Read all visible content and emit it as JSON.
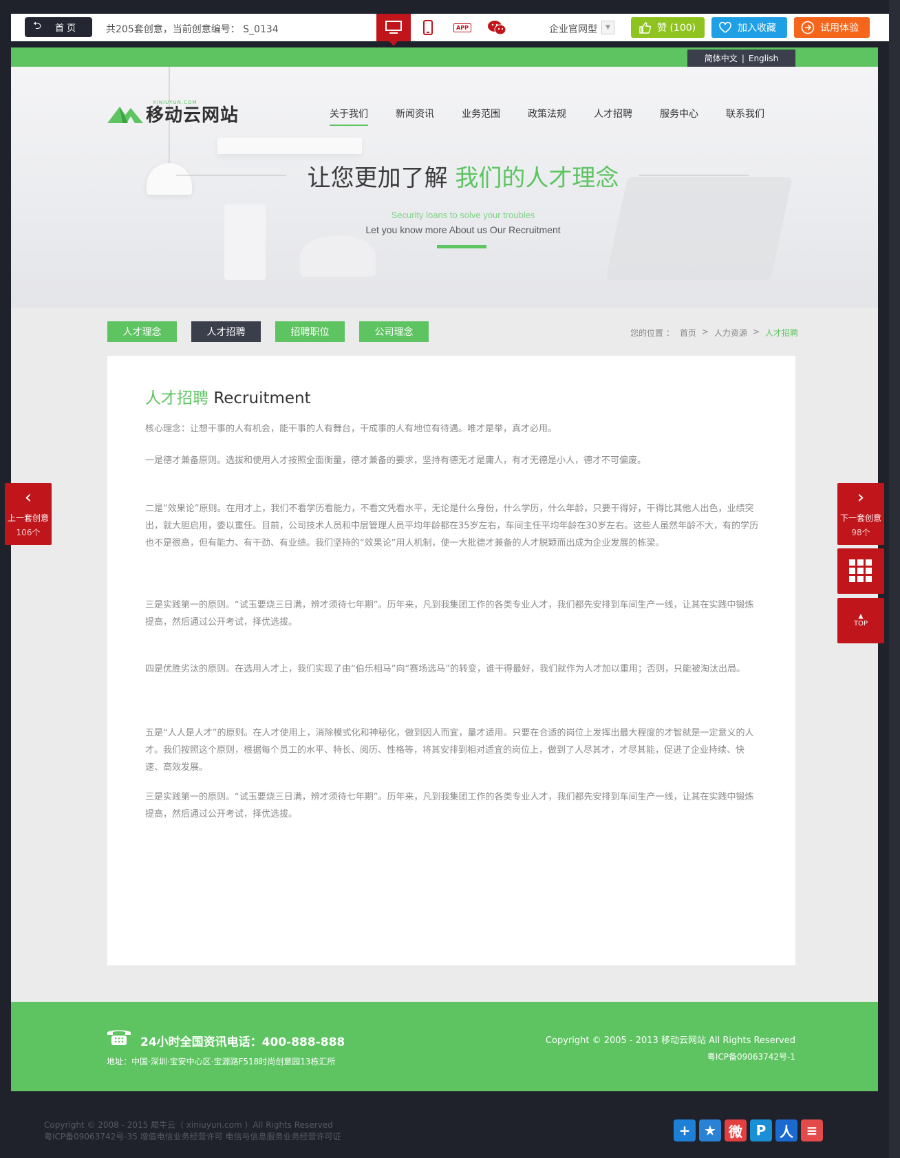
{
  "topbar": {
    "home_label": "首 页",
    "info": "共205套创意，当前创意编号： S_0134",
    "devices": [
      "desktop-icon",
      "tablet-icon",
      "app-icon",
      "wechat-icon"
    ],
    "app_icon_text": "APP",
    "site_type": "企业官网型",
    "like_label": "赞 (100)",
    "fav_label": "加入收藏",
    "trial_label": "试用体验",
    "colors": {
      "dark": "#242631",
      "red": "#c0151b",
      "like": "#8fc31f",
      "fav": "#1fa0e6",
      "trial": "#f5661c"
    }
  },
  "lang": {
    "cn": "简体中文",
    "sep": "|",
    "en": "English"
  },
  "logo": {
    "sub": "XINIUYUN.COM",
    "text": "移动云网站"
  },
  "nav": [
    "关于我们",
    "新闻资讯",
    "业务范围",
    "政策法规",
    "人才招聘",
    "服务中心",
    "联系我们"
  ],
  "hero": {
    "title_pre": "让您更加了解",
    "title_hl": "我们的人才理念",
    "sub1": "Security loans to solve your troubles",
    "sub2": "Let you know more About us Our Recruitment"
  },
  "subtabs": [
    "人才理念",
    "人才招聘",
    "招聘职位",
    "公司理念"
  ],
  "breadcrumb": {
    "label": "您的位置 ：",
    "home": "首页",
    "sep": ">",
    "mid": "人力资源",
    "current": "人才招聘"
  },
  "content": {
    "title_hl": "人才招聘",
    "title_en": "Recruitment",
    "paragraphs": [
      "核心理念：让想干事的人有机会，能干事的人有舞台，干成事的人有地位有待遇。唯才是举，真才必用。",
      "一是德才兼备原则。选拔和使用人才按照全面衡量，德才兼备的要求，坚持有德无才是庸人，有才无德是小人，德才不可偏废。",
      "二是“效果论”原则。在用才上，我们不看学历看能力，不看文凭看水平，无论是什么身份，什么学历，什么年龄，只要干得好，干得比其他人出色，业绩突出，就大胆启用，委以重任。目前，公司技术人员和中层管理人员平均年龄都在35岁左右，车间主任平均年龄在30岁左右。这些人虽然年龄不大，有的学历也不是很高，但有能力、有干劲、有业绩。我们坚持的“效果论”用人机制，使一大批德才兼备的人才脱颖而出成为企业发展的栋梁。",
      "三是实践第一的原则。“试玉要烧三日满，辨才须待七年期”。历年来，凡到我集团工作的各类专业人才，我们都先安排到车间生产一线，让其在实践中锻炼提高，然后通过公开考试，择优选拔。",
      "四是优胜劣汰的原则。在选用人才上，我们实现了由“伯乐相马”向“赛场选马”的转变，谁干得最好，我们就作为人才加以重用；否则，只能被淘汰出局。",
      "五是“人人是人才”的原则。在人才使用上，消除模式化和神秘化，做到因人而宜，量才适用。只要在合适的岗位上发挥出最大程度的才智就是一定意义的人才。我们按照这个原则，根据每个员工的水平、特长、阅历、性格等，将其安排到相对适宜的岗位上，做到了人尽其才，才尽其能，促进了企业持续、快速、高效发展。",
      "三是实践第一的原则。“试玉要烧三日满，辨才须待七年期”。历年来，凡到我集团工作的各类专业人才，我们都先安排到车间生产一线，让其在实践中锻炼提高，然后通过公开考试，择优选拔。"
    ]
  },
  "footer": {
    "phone": "24小时全国资讯电话：400-888-888",
    "address": "地址：中国·深圳·宝安中心区·宝源路F518时尚创意园13栋汇所",
    "copyright": "Copyright © 2005 - 2013 移动云网站  All Rights Reserved",
    "icp": "粤ICP备09063742号-1"
  },
  "side": {
    "prev_label": "上一套创意",
    "prev_count": "106个",
    "next_label": "下一套创意",
    "next_count": "98个",
    "top_label": "TOP"
  },
  "bottom": {
    "copy1": "Copyright © 2008 - 2015 犀牛云（ xiniuyun.com ）All Rights Reserved",
    "copy2": "粤ICP备09063742号-35 增值电信业务经营许可 电信与信息服务业务经营许可证"
  },
  "share_icons": [
    {
      "name": "add-share-icon",
      "glyph": "+",
      "color": "#1e7fd6"
    },
    {
      "name": "qzone-icon",
      "glyph": "★",
      "color": "#2a82d4"
    },
    {
      "name": "weibo-icon",
      "glyph": "微",
      "color": "#e24040"
    },
    {
      "name": "tencent-weibo-icon",
      "glyph": "P",
      "color": "#1a8fd6"
    },
    {
      "name": "renren-icon",
      "glyph": "人",
      "color": "#1b6ad0"
    },
    {
      "name": "more-share-icon",
      "glyph": "≡",
      "color": "#e34a4a"
    }
  ]
}
